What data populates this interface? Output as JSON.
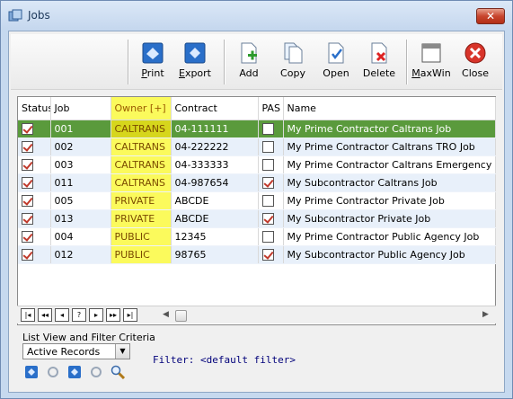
{
  "window": {
    "title": "Jobs",
    "close_label": "✕"
  },
  "toolbar": [
    {
      "label": "Print",
      "underline": "P",
      "rest": "rint"
    },
    {
      "label": "Export",
      "underline": "E",
      "rest": "xport"
    },
    {
      "label": "Add"
    },
    {
      "label": "Copy"
    },
    {
      "label": "Open"
    },
    {
      "label": "Delete"
    },
    {
      "label": "MaxWin",
      "underline": "M",
      "rest": "axWin"
    },
    {
      "label": "Close"
    }
  ],
  "grid": {
    "columns": [
      "Status",
      "Job",
      "Owner [+]",
      "Contract",
      "PAS",
      "Name"
    ],
    "rows": [
      {
        "status": true,
        "job": "001",
        "owner": "CALTRANS",
        "contract": "04-111111",
        "pas": false,
        "name": "My Prime Contractor Caltrans Job",
        "selected": true
      },
      {
        "status": true,
        "job": "002",
        "owner": "CALTRANS",
        "contract": "04-222222",
        "pas": false,
        "name": "My Prime Contractor Caltrans TRO Job"
      },
      {
        "status": true,
        "job": "003",
        "owner": "CALTRANS",
        "contract": "04-333333",
        "pas": false,
        "name": "My Prime Contractor Caltrans Emergency"
      },
      {
        "status": true,
        "job": "011",
        "owner": "CALTRANS",
        "contract": "04-987654",
        "pas": true,
        "name": "My Subcontractor Caltrans Job"
      },
      {
        "status": true,
        "job": "005",
        "owner": "PRIVATE",
        "contract": "ABCDE",
        "pas": false,
        "name": "My Prime Contractor Private Job"
      },
      {
        "status": true,
        "job": "013",
        "owner": "PRIVATE",
        "contract": "ABCDE",
        "pas": true,
        "name": "My Subcontractor Private Job"
      },
      {
        "status": true,
        "job": "004",
        "owner": "PUBLIC",
        "contract": "12345",
        "pas": false,
        "name": "My Prime Contractor Public Agency Job"
      },
      {
        "status": true,
        "job": "012",
        "owner": "PUBLIC",
        "contract": "98765",
        "pas": true,
        "name": "My Subcontractor Public Agency Job"
      }
    ]
  },
  "navigator": {
    "buttons": [
      "|◂",
      "◂◂",
      "◂",
      "?",
      "▸",
      "▸▸",
      "▸|"
    ]
  },
  "filter": {
    "group_label": "List View and Filter Criteria",
    "selected_view": "Active Records",
    "text": "Filter: <default filter>"
  },
  "colors": {
    "selected_row": "#5a9a3c",
    "owner_highlight": "#fbfa5c",
    "alt_row": "#e8f0fa"
  }
}
